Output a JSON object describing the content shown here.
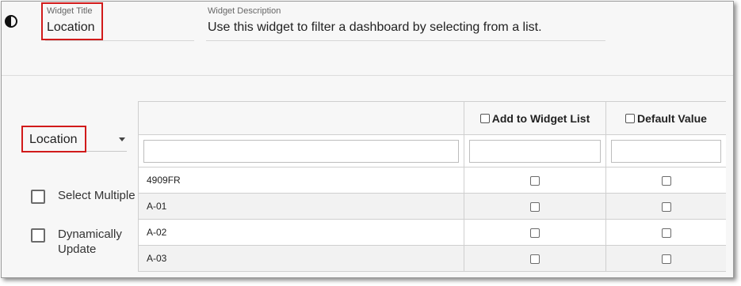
{
  "header": {
    "title_label": "Widget Title",
    "title_value": "Location",
    "description_label": "Widget Description",
    "description_value": "Use this widget to filter a dashboard by selecting from a list.",
    "theme_icon": "contrast-icon"
  },
  "sidebar": {
    "location_select": "Location",
    "select_multiple_label": "Select Multiple",
    "dynamically_update_label": "Dynamically Update"
  },
  "grid": {
    "columns": [
      "",
      "Add to Widget List",
      "Default Value"
    ],
    "rows": [
      {
        "name": "4909FR",
        "add_to_list": false,
        "default": false
      },
      {
        "name": "A-01",
        "add_to_list": false,
        "default": false
      },
      {
        "name": "A-02",
        "add_to_list": false,
        "default": false
      },
      {
        "name": "A-03",
        "add_to_list": false,
        "default": false
      }
    ]
  },
  "colors": {
    "highlight": "#d11a1a",
    "panel_bg": "#f7f7f7"
  }
}
